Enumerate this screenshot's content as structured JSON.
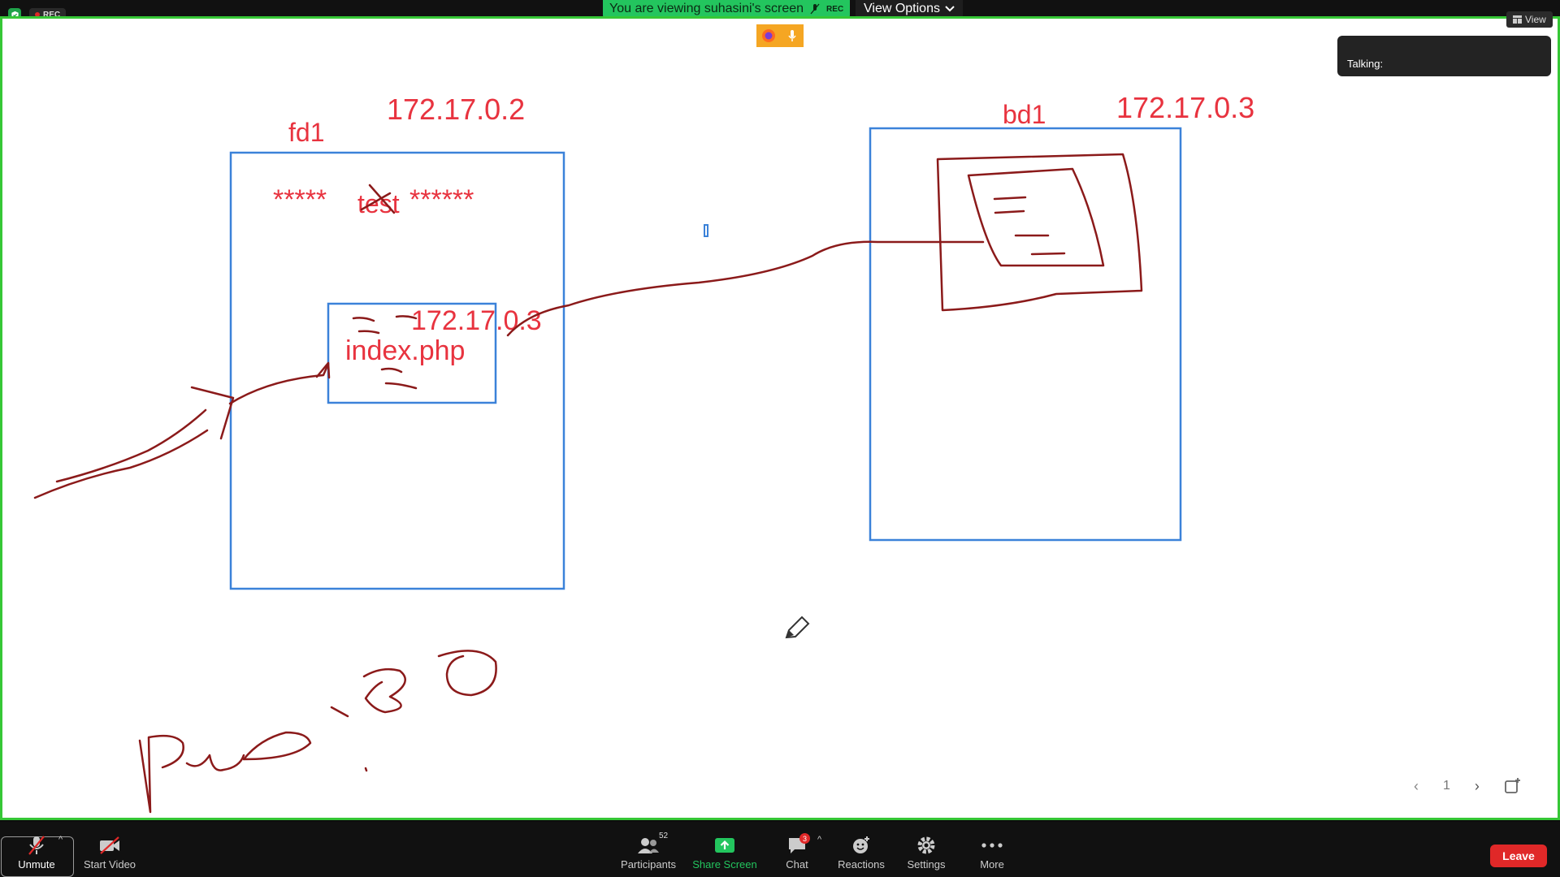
{
  "top_bar": {
    "rec_label": "REC",
    "viewing_text": "You are viewing suhasini's screen",
    "viewing_rec_label": "REC",
    "view_options_label": "View Options",
    "view_label": "View"
  },
  "talking_panel": {
    "label": "Talking:"
  },
  "whiteboard": {
    "fd1_label": "fd1",
    "fd1_ip": "172.17.0.2",
    "masked_text_left": "*****",
    "masked_word": "test",
    "masked_text_right": "******",
    "inner_ip": "172.17.0.3",
    "file_label": "index.php",
    "bd1_label": "bd1",
    "bd1_ip": "172.17.0.3"
  },
  "pager": {
    "page": "1"
  },
  "toolbar": {
    "unmute_label": "Unmute",
    "start_video_label": "Start Video",
    "participants_label": "Participants",
    "participants_count": "52",
    "share_screen_label": "Share Screen",
    "chat_label": "Chat",
    "chat_badge": "3",
    "reactions_label": "Reactions",
    "settings_label": "Settings",
    "more_label": "More",
    "leave_label": "Leave"
  },
  "colors": {
    "share_green": "#23c55e",
    "border_green": "#36c736",
    "diagram_blue": "#3b82d9",
    "text_red": "#e8333f",
    "ink_darkred": "#8b1a1a",
    "leave_red": "#e02828"
  }
}
